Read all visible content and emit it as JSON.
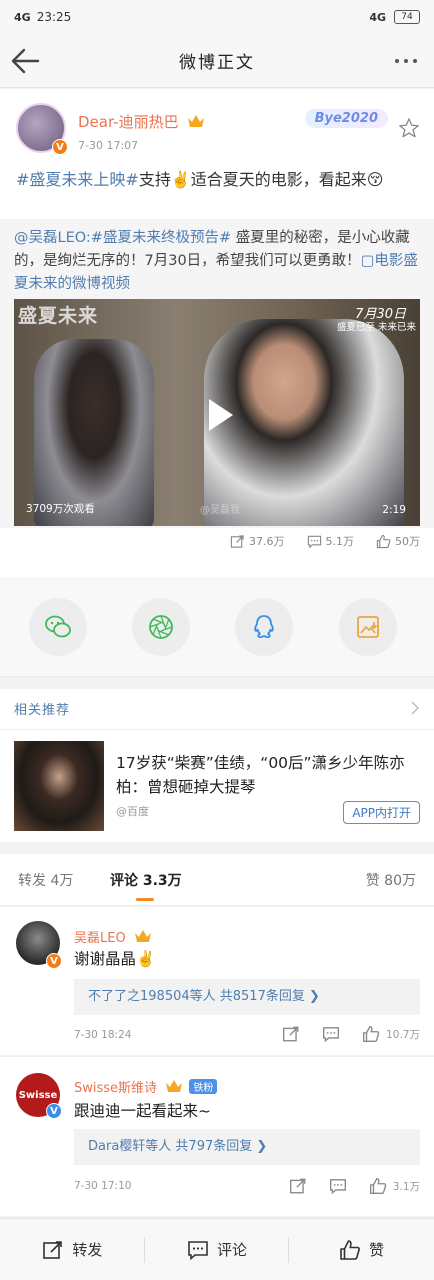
{
  "status_bar": {
    "network": "4G",
    "time": "23:25",
    "battery": "74"
  },
  "nav": {
    "title": "微博正文"
  },
  "post": {
    "author": "Dear-迪丽热巴",
    "time": "7-30 17:07",
    "badge": "Bye2020",
    "text_topic": "#盛夏未来上映#",
    "text_body": "支持✌️适合夏天的电影，看起来😚",
    "repost": {
      "mention": "@吴磊LEO:",
      "topic": "#盛夏未来终极预告#",
      "body": " 盛夏里的秘密，是小心收藏的，是绚烂无序的！7月30日，希望我们可以更勇敢！",
      "video_link": "▢电影盛夏未来的微博视频"
    },
    "video": {
      "title_overlay": "盛夏未来",
      "date_overlay": "7月30日",
      "subtitle_overlay": "盛夏已至 未来已来",
      "views": "3709万次观看",
      "duration": "2:19",
      "watermark": "@吴磊我"
    },
    "counts": {
      "reposts": "37.6万",
      "comments": "5.1万",
      "likes": "50万"
    }
  },
  "share": [
    "wechat-icon",
    "moments-icon",
    "qq-icon",
    "save-image-icon"
  ],
  "related": {
    "header": "相关推荐",
    "title": "17岁获“柴赛”佳绩，“00后”潇乡少年陈亦柏：曾想砸掉大提琴",
    "source": "@百度",
    "open_label": "APP内打开"
  },
  "comment_tabs": {
    "reposts": "转发 4万",
    "comments": "评论 3.3万",
    "likes": "赞 80万"
  },
  "comments": [
    {
      "name": "吴磊LEO",
      "text": "谢谢晶晶✌️",
      "replies": "不了了之198504等人  共8517条回复 ❯",
      "time": "7-30 18:24",
      "likes": "10.7万"
    },
    {
      "name": "Swisse斯维诗",
      "fan_badge": "铁粉",
      "avatar_text": "Swisse",
      "text": "跟迪迪一起看起来~",
      "replies": "Dara樱轩等人  共797条回复 ❯",
      "time": "7-30 17:10",
      "likes": "3.1万"
    }
  ],
  "bottom_bar": {
    "repost": "转发",
    "comment": "评论",
    "like": "赞"
  }
}
